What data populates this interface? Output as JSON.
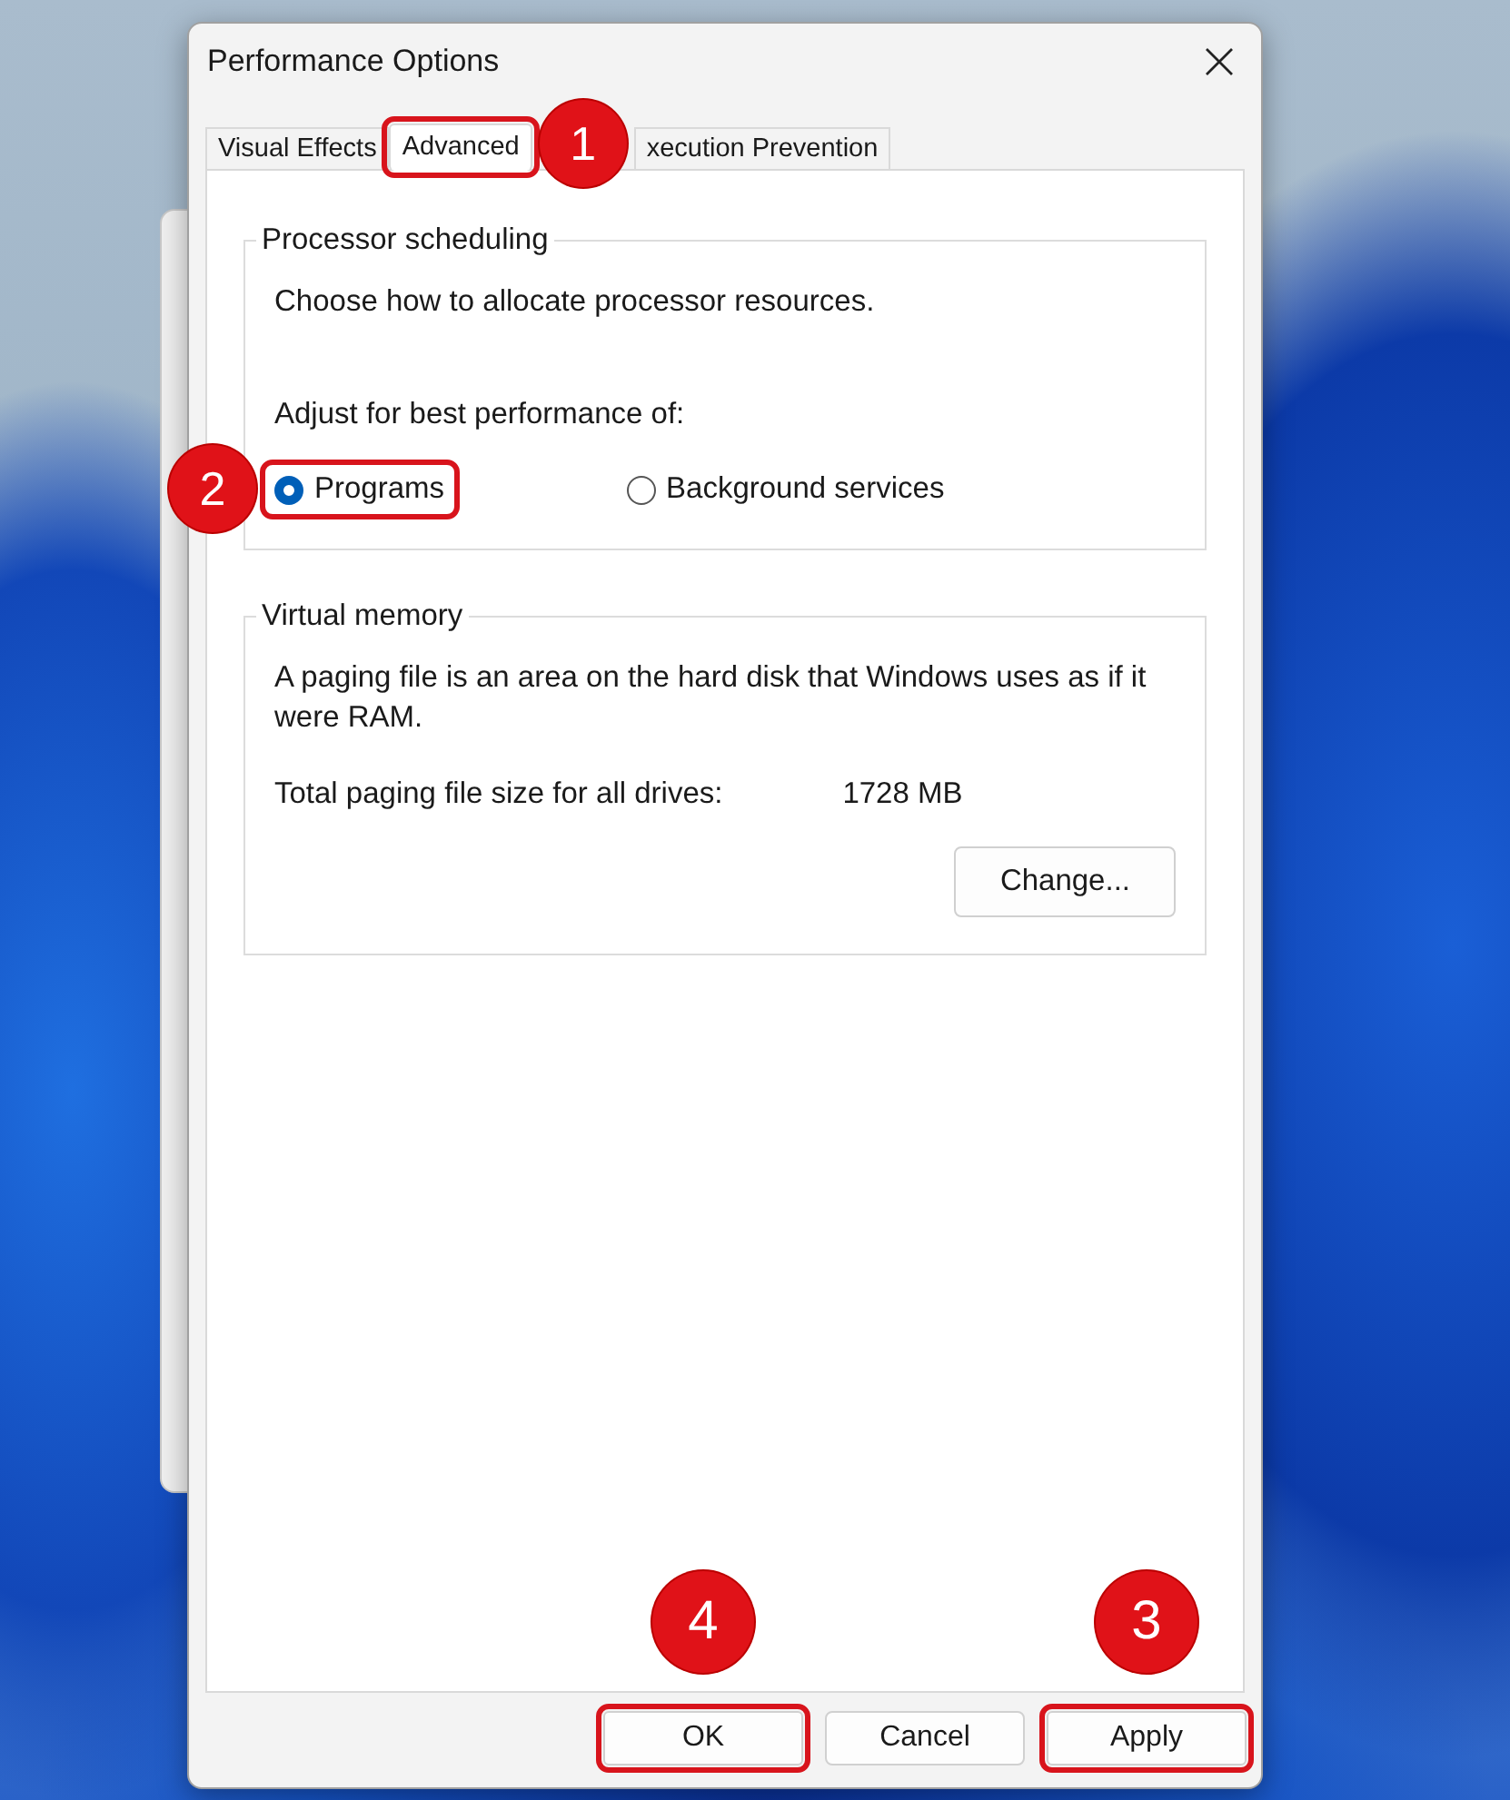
{
  "window": {
    "title": "Performance Options"
  },
  "tabs": [
    {
      "label": "Visual Effects",
      "selected": false,
      "highlighted": false
    },
    {
      "label": "Advanced",
      "selected": true,
      "highlighted": true,
      "badge": "1"
    },
    {
      "label": "xecution Prevention",
      "selected": false,
      "highlighted": false
    }
  ],
  "processor_scheduling": {
    "title": "Processor scheduling",
    "description": "Choose how to allocate processor resources.",
    "prompt": "Adjust for best performance of:",
    "options": [
      {
        "label": "Programs",
        "selected": true,
        "highlighted": true,
        "badge": "2"
      },
      {
        "label": "Background services",
        "selected": false,
        "highlighted": false
      }
    ]
  },
  "virtual_memory": {
    "title": "Virtual memory",
    "description": "A paging file is an area on the hard disk that Windows uses as if it were RAM.",
    "size_label": "Total paging file size for all drives:",
    "size_value": "1728 MB",
    "button": "Change..."
  },
  "buttons": [
    {
      "label": "OK",
      "highlighted": true,
      "badge": "4"
    },
    {
      "label": "Cancel",
      "highlighted": false
    },
    {
      "label": "Apply",
      "highlighted": true,
      "badge": "3"
    }
  ]
}
